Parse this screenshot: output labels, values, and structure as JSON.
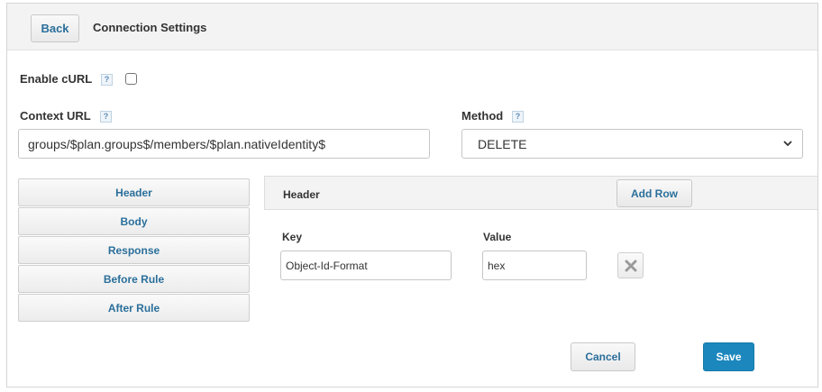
{
  "toolbar": {
    "back_label": "Back",
    "title": "Connection Settings"
  },
  "enable_curl": {
    "label": "Enable cURL",
    "help_glyph": "?",
    "checked": false
  },
  "context_url": {
    "label": "Context URL",
    "help_glyph": "?",
    "value": "groups/$plan.groups$/members/$plan.nativeIdentity$"
  },
  "method": {
    "label": "Method",
    "help_glyph": "?",
    "selected": "DELETE"
  },
  "side_tabs": [
    {
      "label": "Header"
    },
    {
      "label": "Body"
    },
    {
      "label": "Response"
    },
    {
      "label": "Before Rule"
    },
    {
      "label": "After Rule"
    }
  ],
  "header_section": {
    "title": "Header",
    "add_row_label": "Add Row",
    "key_label": "Key",
    "value_label": "Value",
    "rows": [
      {
        "key": "Object-Id-Format",
        "value": "hex"
      }
    ]
  },
  "footer": {
    "cancel_label": "Cancel",
    "save_label": "Save"
  },
  "colors": {
    "accent": "#1b87bd",
    "link_text": "#2a6f9b"
  },
  "icons": {
    "delete": "x-icon",
    "dropdown": "chevron-down-icon",
    "help": "help-icon"
  }
}
